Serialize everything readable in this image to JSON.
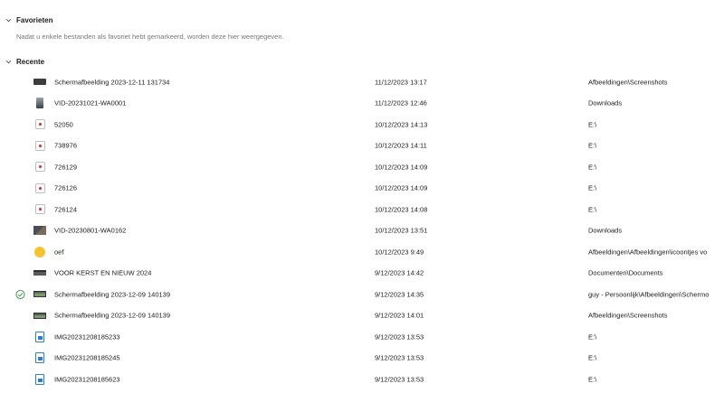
{
  "favorites": {
    "title": "Favorieten",
    "note": "Nadat u enkele bestanden als favoriet hebt gemarkeerd, worden deze hier weergegeven."
  },
  "recent": {
    "title": "Recente",
    "items": [
      {
        "name": "Schermafbeelding 2023-12-11 131734",
        "date": "11/12/2023 13:17",
        "location": "Afbeeldingen\\Screenshots",
        "icon": "screenshot-icon"
      },
      {
        "name": "VID-20231021-WA0001",
        "date": "11/12/2023 12:46",
        "location": "Downloads",
        "icon": "video-icon"
      },
      {
        "name": "52050",
        "date": "10/12/2023 14:13",
        "location": "E:\\",
        "icon": "photo-icon"
      },
      {
        "name": "738976",
        "date": "10/12/2023 14:11",
        "location": "E:\\",
        "icon": "photo-icon"
      },
      {
        "name": "726129",
        "date": "10/12/2023 14:09",
        "location": "E:\\",
        "icon": "photo-icon"
      },
      {
        "name": "726126",
        "date": "10/12/2023 14:09",
        "location": "E:\\",
        "icon": "photo-icon"
      },
      {
        "name": "726124",
        "date": "10/12/2023 14:08",
        "location": "E:\\",
        "icon": "photo-icon"
      },
      {
        "name": "VID-20230801-WA0162",
        "date": "10/12/2023 13:51",
        "location": "Downloads",
        "icon": "video-thumbnail-icon"
      },
      {
        "name": "oef",
        "date": "10/12/2023 9:49",
        "location": "Afbeeldingen\\Afbeeldingen\\icoontjes vo",
        "icon": "emoji-icon"
      },
      {
        "name": "VOOR KERST EN NIEUW 2024",
        "date": "9/12/2023 14:42",
        "location": "Documenten\\Documents",
        "icon": "document-thumbnail-icon"
      },
      {
        "name": "Schermafbeelding 2023-12-09 140139",
        "date": "9/12/2023 14:35",
        "location": "guy - Persoonlijk\\Afbeeldingen\\Schermo",
        "icon": "image-thumbnail-icon",
        "synced": true
      },
      {
        "name": "Schermafbeelding 2023-12-09 140139",
        "date": "9/12/2023 14:01",
        "location": "Afbeeldingen\\Screenshots",
        "icon": "image-thumbnail-icon"
      },
      {
        "name": "IMG20231208185233",
        "date": "9/12/2023 13:53",
        "location": "E:\\",
        "icon": "image-file-icon"
      },
      {
        "name": "IMG20231208185245",
        "date": "9/12/2023 13:53",
        "location": "E:\\",
        "icon": "image-file-icon"
      },
      {
        "name": "IMG20231208185623",
        "date": "9/12/2023 13:53",
        "location": "E:\\",
        "icon": "image-file-icon"
      }
    ]
  },
  "colors": {
    "sync_green": "#2f8f3f",
    "muted_text": "#777777",
    "accent_blue": "#2b7cd3"
  }
}
